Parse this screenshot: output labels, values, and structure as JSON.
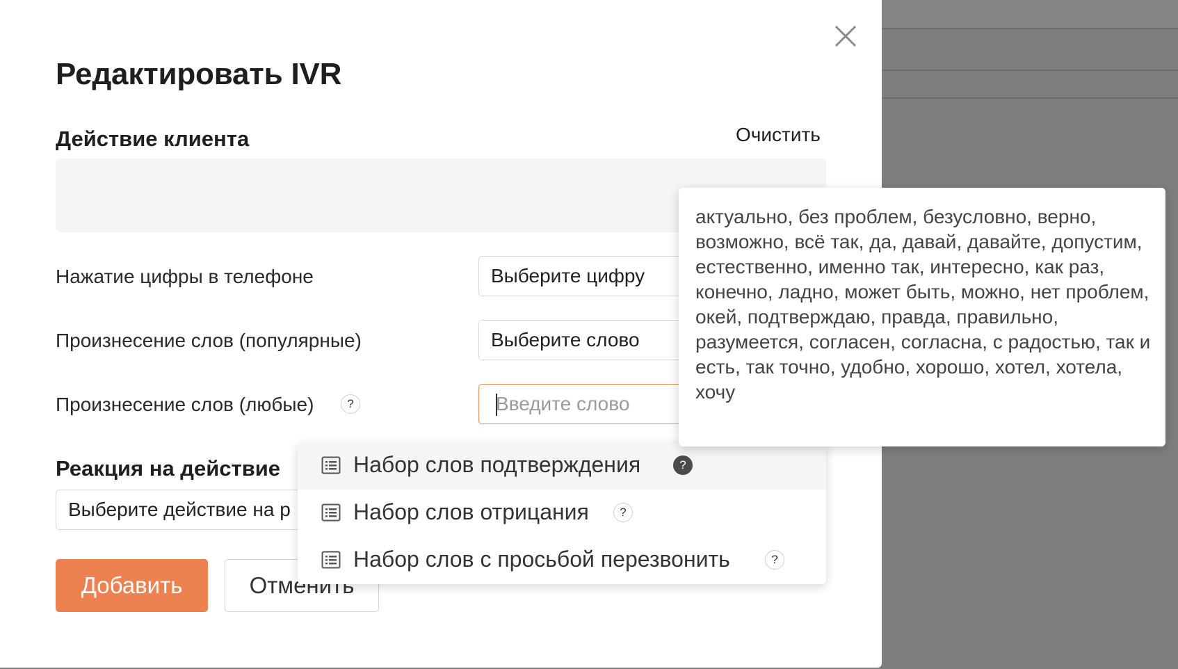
{
  "modal": {
    "title": "Редактировать IVR",
    "close_icon": "close-icon"
  },
  "client_action": {
    "title": "Действие клиента",
    "clear_label": "Очистить"
  },
  "rows": [
    {
      "label": "Нажатие цифры в телефоне",
      "select_value": "Выберите цифру"
    },
    {
      "label": "Произнесение слов (популярные)",
      "select_value": "Выберите слово"
    },
    {
      "label": "Произнесение слов (любые)",
      "help": "?",
      "placeholder": "Введите слово"
    }
  ],
  "reaction": {
    "title": "Реакция на действие",
    "select_value": "Выберите действие на р"
  },
  "buttons": {
    "add": "Добавить",
    "cancel": "Отменить"
  },
  "dropdown": {
    "items": [
      {
        "label": "Набор слов подтверждения",
        "help": "?",
        "icon": "list-icon",
        "highlighted": true
      },
      {
        "label": "Набор слов отрицания",
        "help": "?",
        "icon": "list-icon"
      },
      {
        "label": "Набор слов с просьбой перезвонить",
        "help": "?",
        "icon": "list-icon"
      }
    ]
  },
  "tooltip": {
    "text": "актуально, без проблем, безусловно, верно, возможно, всё так, да, давай, давайте, допустим, естественно, именно так, интересно, как раз, конечно, ладно, может быть, можно, нет проблем, окей, подтверждаю, правда, правильно, разумеется, согласен, согласна, с радостью, так и есть, так точно, удобно, хорошо, хотел, хотела, хочу"
  },
  "colors": {
    "accent": "#ee8150",
    "input_focus_border": "#ef8a52",
    "overlay": "#7e7e7e"
  }
}
